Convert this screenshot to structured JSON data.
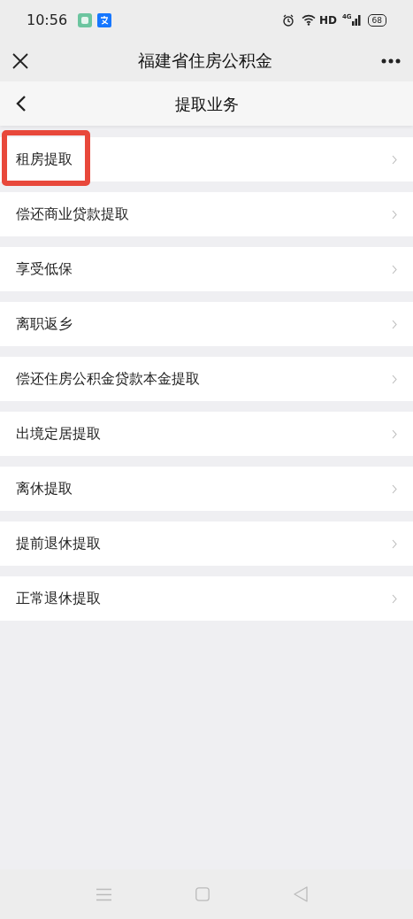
{
  "status_bar": {
    "time": "10:56",
    "network": "HD",
    "cellular": "4G",
    "battery": "68"
  },
  "window": {
    "title": "福建省住房公积金"
  },
  "header": {
    "title": "提取业务"
  },
  "items": [
    {
      "label": "租房提取",
      "highlighted": true
    },
    {
      "label": "偿还商业贷款提取",
      "highlighted": false
    },
    {
      "label": "享受低保",
      "highlighted": false
    },
    {
      "label": "离职返乡",
      "highlighted": false
    },
    {
      "label": "偿还住房公积金贷款本金提取",
      "highlighted": false
    },
    {
      "label": "出境定居提取",
      "highlighted": false
    },
    {
      "label": "离休提取",
      "highlighted": false
    },
    {
      "label": "提前退休提取",
      "highlighted": false
    },
    {
      "label": "正常退休提取",
      "highlighted": false
    }
  ]
}
